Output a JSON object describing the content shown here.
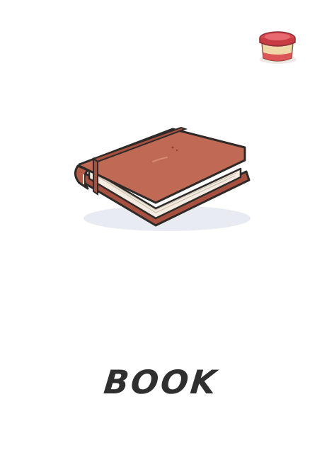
{
  "card": {
    "word": "BOOK",
    "illustration_icon": "book-icon",
    "corner_icon": "jar-icon"
  },
  "colors": {
    "cover": "#c06a55",
    "cover_dark": "#a8503f",
    "pages": "#f4ece0",
    "outline": "#2e2a28",
    "text": "#2f2f2f",
    "jar_lid": "#d9474e",
    "jar_body": "#f0d9a8"
  }
}
